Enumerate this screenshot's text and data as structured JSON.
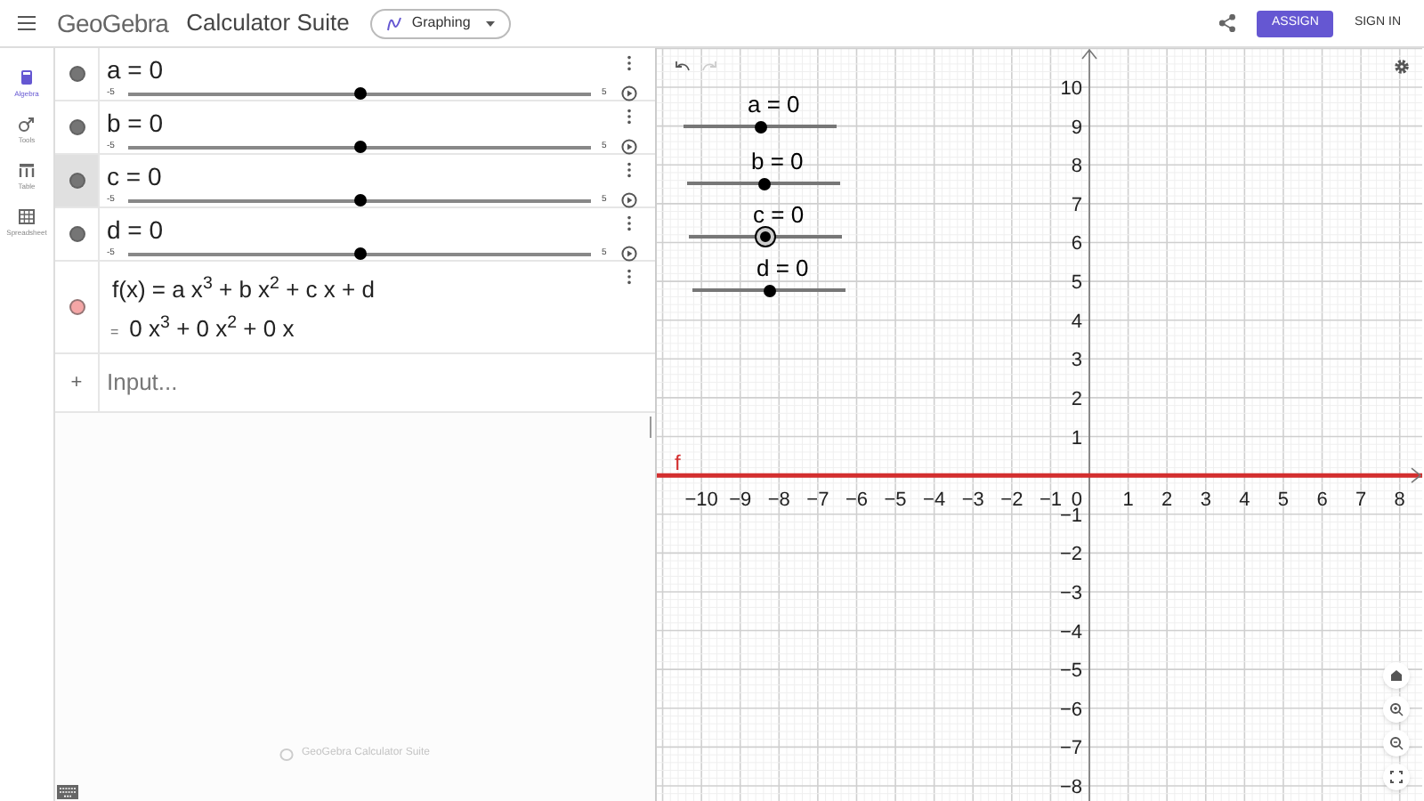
{
  "header": {
    "logo": "GeoGebra",
    "app_title": "Calculator Suite",
    "app_switcher": "Graphing",
    "assign_button": "ASSIGN",
    "sign_in_button": "SIGN IN"
  },
  "side_rail": [
    {
      "label": "Algebra",
      "selected": true
    },
    {
      "label": "Tools",
      "selected": false
    },
    {
      "label": "Table",
      "selected": false
    },
    {
      "label": "Spreadsheet",
      "selected": false
    }
  ],
  "algebra": {
    "items": [
      {
        "kind": "slider",
        "expression": "a = 0",
        "min": "-5",
        "max": "5",
        "level": 0.5,
        "selected": false,
        "color": "#757575"
      },
      {
        "kind": "slider",
        "expression": "b = 0",
        "min": "-5",
        "max": "5",
        "level": 0.5,
        "selected": false,
        "color": "#757575"
      },
      {
        "kind": "slider",
        "expression": "c = 0",
        "min": "-5",
        "max": "5",
        "level": 0.5,
        "selected": true,
        "color": "#757575"
      },
      {
        "kind": "slider",
        "expression": "d = 0",
        "min": "-5",
        "max": "5",
        "level": 0.5,
        "selected": false,
        "color": "#757575"
      },
      {
        "kind": "function",
        "expression": "f(x) = a x$^{3}$ + b x$^{2}$ + c x + d",
        "result_prefix": "=",
        "result": "0 x$^{3}$ + 0 x$^{2}$ + 0 x",
        "selected": false,
        "color": "#f4a6a6"
      }
    ],
    "input_icon": "+",
    "input_placeholder": "Input...",
    "footer": "GeoGebra Calculator Suite"
  },
  "graphics": {
    "sliders": [
      {
        "label": "a = 0",
        "level": 0.5,
        "selected": false
      },
      {
        "label": "b = 0",
        "level": 0.5,
        "selected": false
      },
      {
        "label": "c = 0",
        "level": 0.5,
        "selected": true
      },
      {
        "label": "d = 0",
        "level": 0.5,
        "selected": false
      }
    ],
    "origin_label": "0",
    "chart_data": {
      "type": "line",
      "x": [
        -11.15,
        8.58
      ],
      "series": [
        {
          "name": "f",
          "color": "#d32f2f",
          "values": [
            0,
            0
          ]
        }
      ],
      "xlim": [
        -11.15,
        8.58
      ],
      "ylim": [
        -8.39,
        11.01
      ],
      "grid": true,
      "xticks": [
        {
          "value": -10,
          "label": "−10"
        },
        {
          "value": -9,
          "label": "−9"
        },
        {
          "value": -8,
          "label": "−8"
        },
        {
          "value": -7,
          "label": "−7"
        },
        {
          "value": -6,
          "label": "−6"
        },
        {
          "value": -5,
          "label": "−5"
        },
        {
          "value": -4,
          "label": "−4"
        },
        {
          "value": -3,
          "label": "−3"
        },
        {
          "value": -2,
          "label": "−2"
        },
        {
          "value": -1,
          "label": "−1"
        },
        {
          "value": 1,
          "label": "1"
        },
        {
          "value": 2,
          "label": "2"
        },
        {
          "value": 3,
          "label": "3"
        },
        {
          "value": 4,
          "label": "4"
        },
        {
          "value": 5,
          "label": "5"
        },
        {
          "value": 6,
          "label": "6"
        },
        {
          "value": 7,
          "label": "7"
        },
        {
          "value": 8,
          "label": "8"
        }
      ],
      "yticks": [
        {
          "value": 10,
          "label": "10"
        },
        {
          "value": 9,
          "label": "9"
        },
        {
          "value": 8,
          "label": "8"
        },
        {
          "value": 7,
          "label": "7"
        },
        {
          "value": 6,
          "label": "6"
        },
        {
          "value": 5,
          "label": "5"
        },
        {
          "value": 4,
          "label": "4"
        },
        {
          "value": 3,
          "label": "3"
        },
        {
          "value": 2,
          "label": "2"
        },
        {
          "value": 1,
          "label": "1"
        },
        {
          "value": -1,
          "label": "−1"
        },
        {
          "value": -2,
          "label": "−2"
        },
        {
          "value": -3,
          "label": "−3"
        },
        {
          "value": -4,
          "label": "−4"
        },
        {
          "value": -5,
          "label": "−5"
        },
        {
          "value": -6,
          "label": "−6"
        },
        {
          "value": -7,
          "label": "−7"
        },
        {
          "value": -8,
          "label": "−8"
        }
      ]
    }
  }
}
